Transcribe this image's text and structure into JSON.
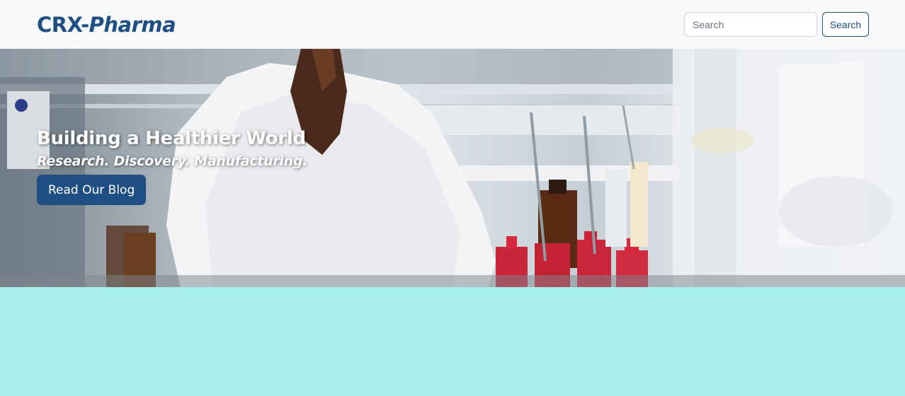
{
  "brand": {
    "prefix": "CRX-",
    "suffix": "Pharma"
  },
  "search": {
    "placeholder": "Search",
    "button_label": "Search"
  },
  "hero": {
    "title": "Building a Healthier World",
    "subtitle": "Research. Discovery. Manufacturing.",
    "cta_label": "Read Our Blog"
  },
  "colors": {
    "brand": "#1f4e82",
    "navbar_bg": "#f8f9fa",
    "page_bg": "#a6f0e9"
  }
}
